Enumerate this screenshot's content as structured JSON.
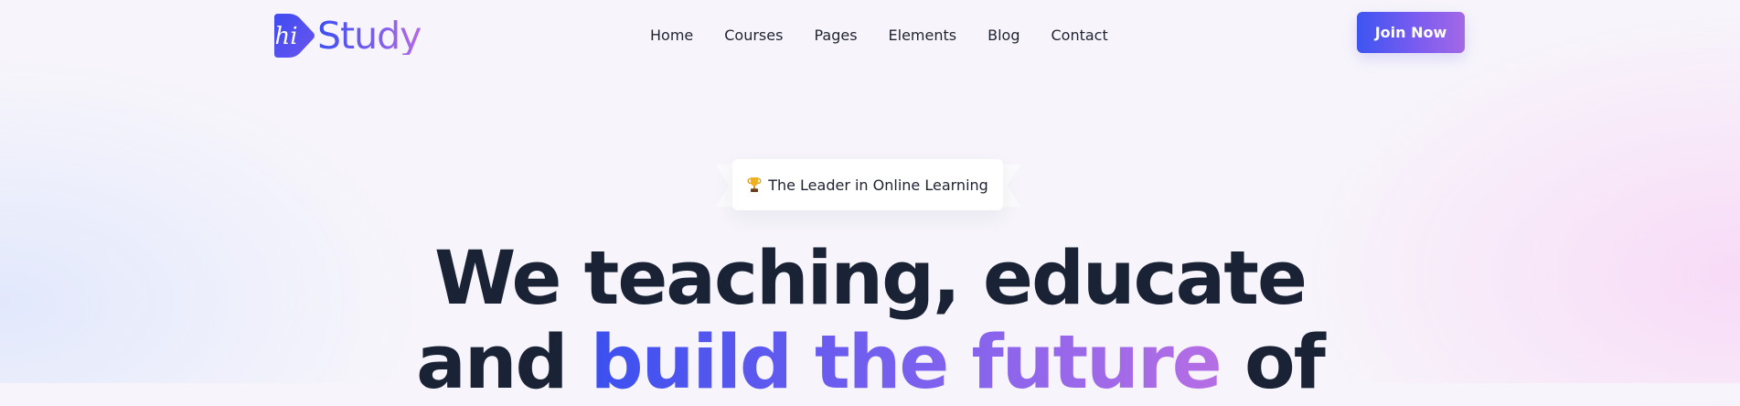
{
  "brand": {
    "mark_text": "hi",
    "name": "Study",
    "colors": {
      "primary": "#3b4ff0",
      "secondary": "#b36ae6"
    }
  },
  "nav": {
    "items": [
      {
        "label": "Home"
      },
      {
        "label": "Courses"
      },
      {
        "label": "Pages"
      },
      {
        "label": "Elements"
      },
      {
        "label": "Blog"
      },
      {
        "label": "Contact"
      }
    ]
  },
  "cta": {
    "join_label": "Join Now"
  },
  "badge": {
    "icon": "trophy-icon",
    "text": "The Leader in Online Learning"
  },
  "hero": {
    "line1": "We teaching, educate",
    "line2_start": "and",
    "line2_highlight": "build the future",
    "line2_end": "of",
    "text_color": "#192335"
  }
}
